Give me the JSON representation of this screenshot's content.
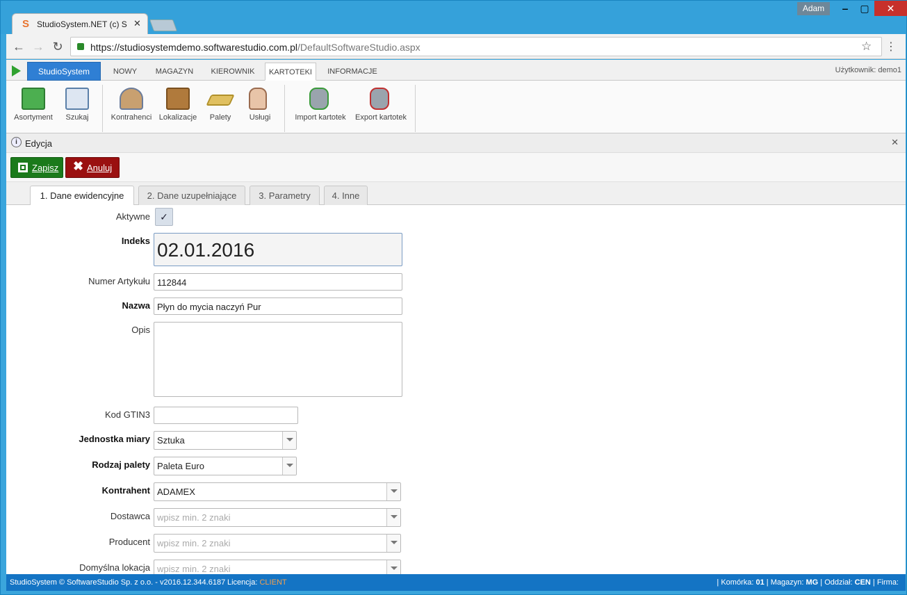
{
  "window": {
    "user_badge": "Adam",
    "tab_title": "StudioSystem.NET (c) Sof",
    "url_host": "https://studiosystemdemo.softwarestudio.com.pl",
    "url_path": "/DefaultSoftwareStudio.aspx"
  },
  "app": {
    "brand": "StudioSystem",
    "tabs": [
      {
        "label": "NOWY"
      },
      {
        "label": "MAGAZYN"
      },
      {
        "label": "KIEROWNIK"
      },
      {
        "label": "KARTOTEKI"
      },
      {
        "label": "INFORMACJE"
      }
    ],
    "user_label": "Użytkownik: demo1",
    "ribbon": [
      {
        "label": "Asortyment",
        "icon": "product-icon"
      },
      {
        "label": "Szukaj",
        "icon": "search-info-icon"
      },
      {
        "label": "Kontrahenci",
        "icon": "contractors-icon"
      },
      {
        "label": "Lokalizacje",
        "icon": "shelf-icon"
      },
      {
        "label": "Palety",
        "icon": "pallet-icon"
      },
      {
        "label": "Usługi",
        "icon": "service-hand-icon"
      },
      {
        "label": "Import kartotek",
        "icon": "db-import-icon"
      },
      {
        "label": "Export kartotek",
        "icon": "db-export-icon"
      }
    ]
  },
  "edit": {
    "title": "Edycja",
    "save_label": "Zapisz",
    "cancel_label": "Anuluj",
    "form_tabs": [
      {
        "label": "1. Dane ewidencyjne"
      },
      {
        "label": "2. Dane uzupełniające"
      },
      {
        "label": "3. Parametry"
      },
      {
        "label": "4. Inne"
      }
    ]
  },
  "form": {
    "active_label": "Aktywne",
    "active_checked": "✓",
    "index_label": "Indeks",
    "index_value": "02.01.2016",
    "article_label": "Numer Artykułu",
    "article_value": "112844",
    "name_label": "Nazwa",
    "name_value": "Płyn do mycia naczyń Pur",
    "desc_label": "Opis",
    "desc_value": "",
    "gtin_label": "Kod GTIN3",
    "gtin_value": "",
    "unit_label": "Jednostka miary",
    "unit_value": "Sztuka",
    "pallet_label": "Rodzaj palety",
    "pallet_value": "Paleta Euro",
    "contractor_label": "Kontrahent",
    "contractor_value": "ADAMEX",
    "supplier_label": "Dostawca",
    "supplier_placeholder": "wpisz min. 2 znaki",
    "producer_label": "Producent",
    "producer_placeholder": "wpisz min. 2 znaki",
    "location_label": "Domyślna lokacja",
    "location_placeholder": "wpisz min. 2 znaki"
  },
  "status": {
    "left": "StudioSystem © SoftwareStudio Sp. z o.o. - v2016.12.344.6187",
    "license_label": "Licencja:",
    "license_value": "CLIENT",
    "cell_label": "Komórka:",
    "cell_value": "01",
    "warehouse_label": "Magazyn:",
    "warehouse_value": "MG",
    "branch_label": "Oddział:",
    "branch_value": "CEN",
    "company_label": "Firma:"
  }
}
